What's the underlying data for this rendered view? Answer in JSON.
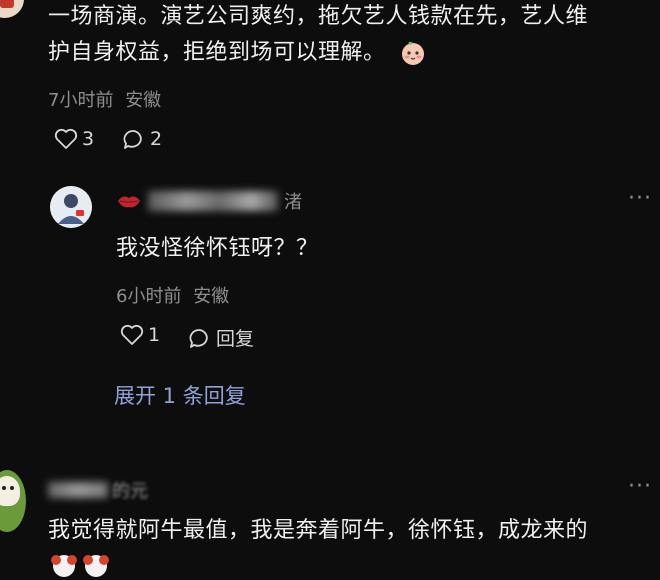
{
  "comment1": {
    "text_line1": "一场商演。演艺公司爽约，拖欠艺人钱款在先，艺人维",
    "text_line2": "护自身权益，拒绝到场可以理解。",
    "emoji": "peach-face-emoji",
    "time": "7小时前",
    "location": "安徽",
    "like_count": "3",
    "reply_count": "2"
  },
  "reply1": {
    "username_suffix": "渚",
    "text": "我没怪徐怀钰呀？？",
    "time": "6小时前",
    "location": "安徽",
    "like_count": "1",
    "reply_label": "回复",
    "more": "···"
  },
  "expand": {
    "label": "展开 1 条回复"
  },
  "comment2": {
    "username_partial": "的元",
    "text": "我觉得就阿牛最值，我是奔着阿牛，徐怀钰，成龙来的",
    "more": "···"
  },
  "colors": {
    "background": "#0d0d0d",
    "link": "#8fa3d6",
    "meta": "#8e8e8e"
  }
}
